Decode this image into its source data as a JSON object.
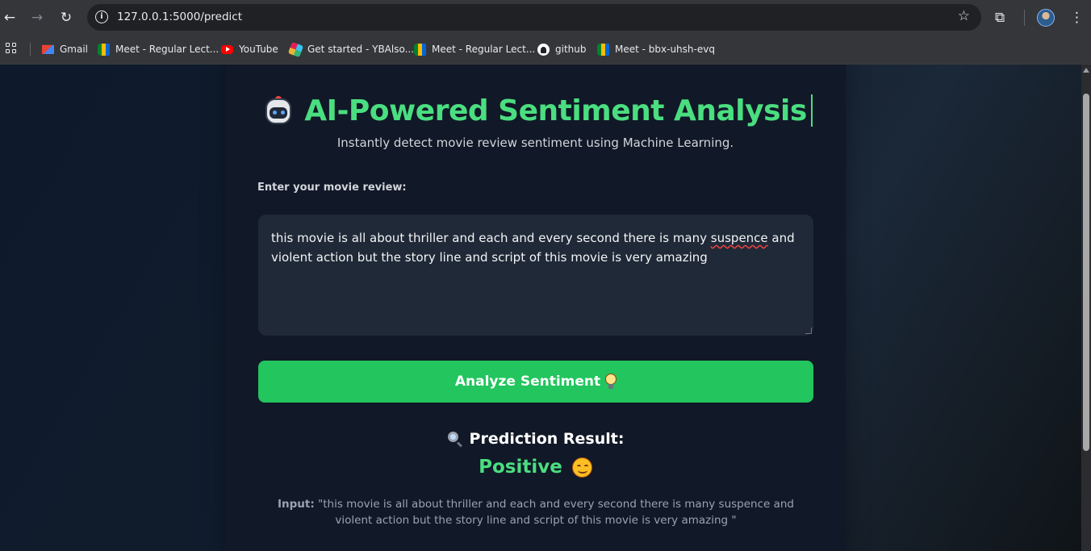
{
  "browser": {
    "url": "127.0.0.1:5000/predict",
    "bookmarks": [
      {
        "label": "Gmail",
        "icon": "gmail-icon"
      },
      {
        "label": "Meet - Regular Lect...",
        "icon": "meet-icon"
      },
      {
        "label": "YouTube",
        "icon": "youtube-icon"
      },
      {
        "label": "Get started - YBAlso...",
        "icon": "slack-icon"
      },
      {
        "label": "Meet - Regular Lect...",
        "icon": "meet-icon"
      },
      {
        "label": "github",
        "icon": "github-icon"
      },
      {
        "label": "Meet - bbx-uhsh-evq",
        "icon": "meet-icon"
      }
    ]
  },
  "app": {
    "title": "AI-Powered Sentiment Analysis",
    "title_icon": "robot-icon",
    "subtitle": "Instantly detect movie review sentiment using Machine Learning.",
    "review_label": "Enter your movie review:",
    "review_text_before": "this movie is all about thriller and each and every second  there is many ",
    "review_misspelled": "suspence",
    "review_text_after": " and violent action but the story line and script of this movie is very amazing",
    "analyze_button": "Analyze Sentiment",
    "analyze_icon": "lightbulb-icon",
    "result_heading": "Prediction Result:",
    "result_icon": "magnifier-icon",
    "sentiment": "Positive",
    "sentiment_icon": "smiling-face-icon",
    "input_label": "Input:",
    "input_echo": "\"this movie is all about thriller and each and every second there is many suspence and violent action but the story line and script of this movie is very amazing \""
  },
  "colors": {
    "accent": "#4ade80",
    "button": "#22c55e",
    "card": "#111827",
    "textarea": "#1f2937"
  }
}
